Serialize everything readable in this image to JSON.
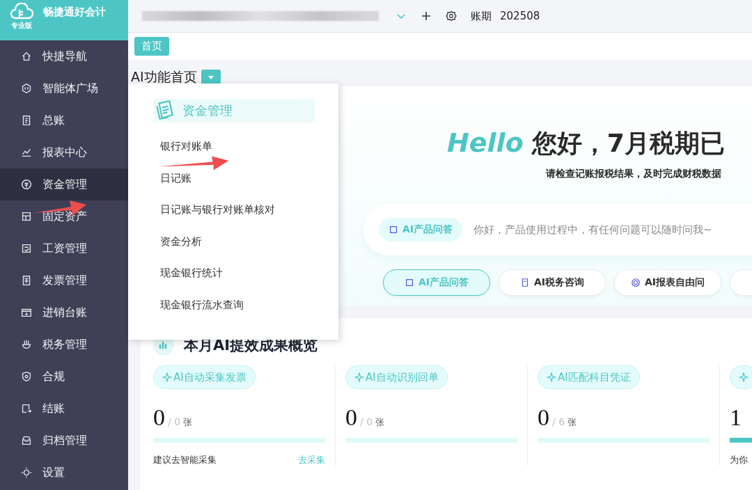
{
  "brand": {
    "name": "畅捷通好会计",
    "edition": "专业版"
  },
  "topbar": {
    "period_label": "账期",
    "period": "202508"
  },
  "tabs": [
    {
      "label": "首页",
      "selected": true
    }
  ],
  "page_title": "AI功能首页",
  "sidebar": {
    "items": [
      {
        "label": "快捷导航",
        "selected": false
      },
      {
        "label": "智能体广场",
        "selected": false
      },
      {
        "label": "总账",
        "selected": false
      },
      {
        "label": "报表中心",
        "selected": false
      },
      {
        "label": "资金管理",
        "selected": true
      },
      {
        "label": "固定资产",
        "selected": false
      },
      {
        "label": "工资管理",
        "selected": false
      },
      {
        "label": "发票管理",
        "selected": false
      },
      {
        "label": "进销台账",
        "selected": false
      },
      {
        "label": "税务管理",
        "selected": false
      },
      {
        "label": "合规",
        "selected": false
      },
      {
        "label": "结账",
        "selected": false
      },
      {
        "label": "归档管理",
        "selected": false
      },
      {
        "label": "设置",
        "selected": false
      }
    ]
  },
  "flyout": {
    "title": "资金管理",
    "items": [
      "银行对账单",
      "日记账",
      "日记账与银行对账单核对",
      "资金分析",
      "现金银行统计",
      "现金银行流水查询"
    ]
  },
  "hero": {
    "hello": "Hello",
    "headline": "您好，7月税期已",
    "subtitle": "请检查记账报税结果，及时完成财税数据"
  },
  "chat": {
    "mode": "AI产品问答",
    "placeholder": "你好，产品使用过程中，有任何问题可以随时问我~"
  },
  "quick_buttons": [
    {
      "label": "AI产品问答",
      "selected": true
    },
    {
      "label": "AI税务咨询",
      "selected": false
    },
    {
      "label": "AI报表自由问",
      "selected": false
    },
    {
      "selected": false
    }
  ],
  "overview": {
    "title": "本月AI提效成果概览",
    "cards": [
      {
        "tag": "AI自动采集发票",
        "value": "0",
        "total": "/ 0",
        "unit": "张",
        "level": 0,
        "hint": "建议去智能采集",
        "link": "去采集"
      },
      {
        "tag": "AI自动识别回单",
        "value": "0",
        "total": "/ 0",
        "unit": "张",
        "level": 0
      },
      {
        "tag": "AI匹配科目凭证",
        "value": "0",
        "total": "/ 6",
        "unit": "张",
        "level": 0
      },
      {
        "value": "1",
        "level": 0.2,
        "hint": "为你"
      }
    ]
  }
}
